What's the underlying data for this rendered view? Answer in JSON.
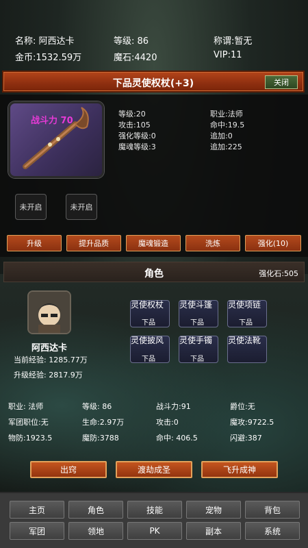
{
  "top": {
    "name_label": "名称: 阿西达卡",
    "level_label": "等级: 86",
    "title_label": "称谓:暂无",
    "gold_label": "金币:1532.59万",
    "stone_label": "魔石:4420",
    "vip_label": "VIP:11"
  },
  "item": {
    "title": "下品灵使权杖(+3)",
    "close_label": "关闭",
    "frame_text": "战斗力 70",
    "stats_left": [
      "等级:20",
      "攻击:105",
      "强化等级:0",
      "魔魂等级:3"
    ],
    "stats_right": [
      "职业:法师",
      "命中:19.5",
      "追加:0",
      "追加:225"
    ],
    "slots": [
      "未开启",
      "未开启"
    ],
    "actions": [
      "升级",
      "提升品质",
      "魔魂锻造",
      "洗炼",
      "强化(10)"
    ]
  },
  "role": {
    "title": "角色",
    "stone_label": "强化石:505",
    "name": "阿西达卡",
    "exp_current": "当前经验:  1285.77万",
    "exp_next": "升级经验:  2817.9万",
    "equips": [
      {
        "name": "灵使权杖",
        "grade": "下品"
      },
      {
        "name": "灵使斗篷",
        "grade": "下品"
      },
      {
        "name": "灵使项链",
        "grade": "下品"
      },
      {
        "name": "灵使披风",
        "grade": "下品"
      },
      {
        "name": "灵使手镯",
        "grade": "下品"
      },
      {
        "name": "灵使法靴",
        "grade": ""
      }
    ],
    "stats": [
      [
        "职业: 法师",
        "等级: 86",
        "战斗力:91",
        "爵位:无"
      ],
      [
        "军团职位:无",
        "生命:2.97万",
        "攻击:0",
        "魔攻:9722.5"
      ],
      [
        "物防:1923.5",
        "魔防:3788",
        "命中: 406.5",
        "闪避:387"
      ]
    ],
    "buttons": [
      "出窍",
      "渡劫成圣",
      "飞升成神"
    ]
  },
  "nav": {
    "row1": [
      "主页",
      "角色",
      "技能",
      "宠物",
      "背包"
    ],
    "row2": [
      "军团",
      "领地",
      "PK",
      "副本",
      "系统"
    ]
  },
  "colors": {
    "title_bar": "#8e2f10",
    "action_button": "#93340f",
    "frame_text": "#e63ad6"
  }
}
